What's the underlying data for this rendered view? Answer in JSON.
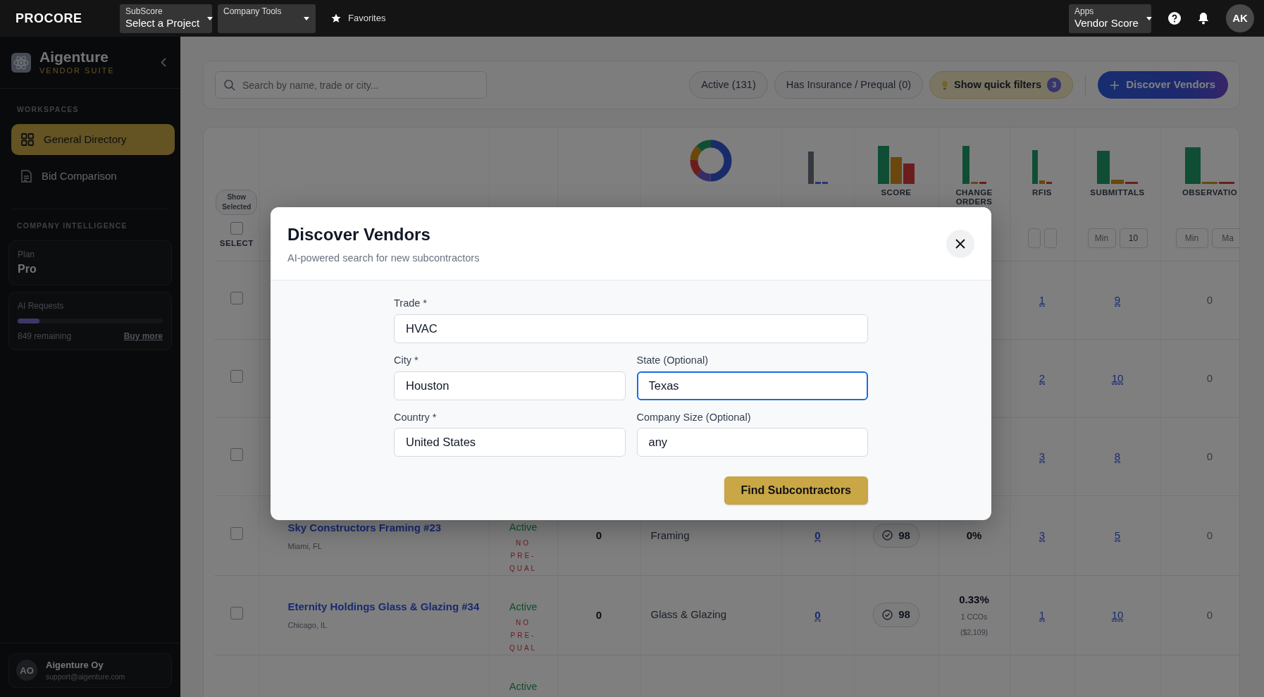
{
  "topbar": {
    "logo": "PROCORE",
    "project_picker": {
      "label": "SubScore",
      "value": "Select a Project"
    },
    "tools_picker": {
      "label": "Company Tools"
    },
    "favorites": "Favorites",
    "apps_picker": {
      "label": "Apps",
      "value": "Vendor Score"
    },
    "avatar": "AK"
  },
  "sidebar": {
    "brand": "Aigenture",
    "tagline": "VENDOR SUITE",
    "workspaces": {
      "heading": "WORKSPACES",
      "items": [
        {
          "label": "General Directory",
          "kind": "grid",
          "selected": true
        },
        {
          "label": "Bid Comparison",
          "kind": "document",
          "selected": false
        }
      ]
    },
    "intelligence": {
      "heading": "COMPANY INTELLIGENCE",
      "plan": {
        "label": "Plan",
        "value": "Pro"
      },
      "ai_requests": {
        "label": "AI Requests",
        "level": 0.15,
        "remaining": "849 remaining",
        "link": "Buy more"
      }
    },
    "account": {
      "initials": "AO",
      "name": "Aigenture Oy",
      "email": "support@aigenture.com"
    }
  },
  "toolbar": {
    "search": {
      "placeholder": "Search by name, trade or city..."
    },
    "filters": [
      {
        "label": "Active (131)"
      },
      {
        "label": "Has Insurance / Prequal (0)"
      }
    ],
    "quick_filters": {
      "label": "Show quick filters",
      "count": "3"
    },
    "primary_button": {
      "label": "Discover Vendors"
    }
  },
  "table": {
    "columns": [
      {
        "kind": "select",
        "pill": "Show Selected",
        "title": "SELECT",
        "checked": false
      },
      {
        "kind": "plain"
      },
      {
        "kind": "plain"
      },
      {
        "kind": "plain"
      },
      {
        "kind": "donut"
      },
      {
        "kind": "metric"
      },
      {
        "kind": "metric",
        "title": "SCORE"
      },
      {
        "kind": "metric",
        "title": "CHANGE ORDERS"
      },
      {
        "kind": "metric",
        "title": "RFIS",
        "filters": [
          {
            "kind": "blank"
          },
          {
            "kind": "blank"
          }
        ]
      },
      {
        "kind": "metric",
        "title": "SUBMITTALS",
        "filters": [
          {
            "placeholder": "Min"
          },
          {
            "value": "10"
          }
        ]
      },
      {
        "kind": "metric",
        "title": "OBSERVATIO",
        "filters": [
          {
            "placeholder": "Min"
          },
          {
            "placeholder": "Ma"
          }
        ]
      }
    ],
    "rows": [
      {
        "checked": false,
        "rfis": "1",
        "submittals": "9",
        "observations": "0"
      },
      {
        "checked": false,
        "rfis": "2",
        "submittals": "10",
        "observations": "0"
      },
      {
        "checked": false,
        "rfis": "3",
        "submittals": "8",
        "observations": "0"
      },
      {
        "checked": false,
        "name": "Sky Constructors Framing #23",
        "location": "Miami, FL",
        "status": "Active",
        "prequal": "NO PRE-QUAL",
        "column_4": "0",
        "trade": "Framing",
        "column_6": "0",
        "score": "98",
        "change_orders": {
          "percent": "0%"
        },
        "rfis": "3",
        "submittals": "5",
        "observations": "0"
      },
      {
        "checked": false,
        "name": "Eternity Holdings Glass & Glazing #34",
        "location": "Chicago, IL",
        "status": "Active",
        "prequal": "NO PRE-QUAL",
        "column_4": "0",
        "trade": "Glass & Glazing",
        "column_6": "0",
        "score": "98",
        "change_orders": {
          "percent": "0.33%",
          "count": "1 CCOs",
          "amount": "($2,109)"
        },
        "rfis": "1",
        "submittals": "10",
        "observations": "0"
      },
      {
        "status": "Active"
      }
    ]
  },
  "modal": {
    "title": "Discover Vendors",
    "subtitle": "AI-powered search for new subcontractors",
    "fields": [
      {
        "label": "Trade *",
        "value": "HVAC",
        "focused": false
      },
      {
        "label": "City *",
        "value": "Houston",
        "focused": false
      },
      {
        "label": "State (Optional)",
        "value": "Texas",
        "focused": true
      },
      {
        "label": "Country *",
        "value": "United States",
        "focused": false
      },
      {
        "label": "Company Size (Optional)",
        "value": "any",
        "focused": false
      }
    ],
    "submit": "Find Subcontractors"
  }
}
